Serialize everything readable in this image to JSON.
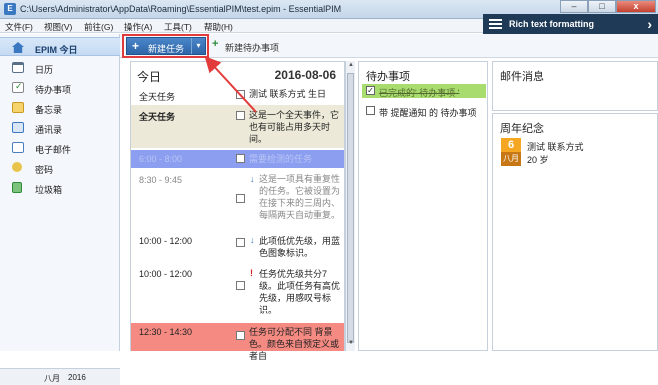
{
  "window": {
    "title": "C:\\Users\\Administrator\\AppData\\Roaming\\EssentialPIM\\test.epim - EssentialPIM"
  },
  "menu": [
    "文件(F)",
    "视图(V)",
    "前往(G)",
    "操作(A)",
    "工具(T)",
    "帮助(H)"
  ],
  "rich_text": {
    "label": "Rich text formatting",
    "close": "›"
  },
  "window_buttons": {
    "minimize": "–",
    "maximize": "□",
    "close": "x"
  },
  "sidebar": {
    "items": [
      {
        "label": "EPIM 今日",
        "icon": "home-icon",
        "color": "#3a78c2"
      },
      {
        "label": "日历",
        "icon": "calendar-icon",
        "color": "#5a6f88"
      },
      {
        "label": "待办事项",
        "icon": "todo-icon",
        "color": "#2f8a3a"
      },
      {
        "label": "备忘录",
        "icon": "notes-icon",
        "color": "#e0a020"
      },
      {
        "label": "通讯录",
        "icon": "contacts-icon",
        "color": "#3a78c2"
      },
      {
        "label": "电子邮件",
        "icon": "email-icon",
        "color": "#4a7fc0"
      },
      {
        "label": "密码",
        "icon": "key-icon",
        "color": "#c9a020"
      },
      {
        "label": "垃圾箱",
        "icon": "trash-icon",
        "color": "#2f8a3a"
      }
    ],
    "footer": {
      "month": "八月",
      "year": "2016"
    }
  },
  "toolbar": {
    "new_task": "新建任务",
    "new_task_dropdown": "▾",
    "new_todo": "新建待办事项"
  },
  "day": {
    "header": "今日",
    "date": "2016-08-06",
    "allday_label": "全天任务",
    "allday_text": "测试 联系方式 生日",
    "rows": [
      {
        "time": "全天任务",
        "text": "这是一个全天事件，它也有可能占用多天时间。",
        "bg": "#ece9d8",
        "color": "#222",
        "prio": ""
      },
      {
        "time": "6:00 - 8:00",
        "text": "需要检测的任务",
        "bg": "#8c9ef0",
        "color": "#b9c5f5",
        "prio": ""
      },
      {
        "time": "8:30 - 9:45",
        "text": "这是一项具有重复性的任务。它被设置为在接下来的三周内、每隔两天自动重复。",
        "bg": "#ffffff",
        "color": "#888",
        "prio": "↓"
      },
      {
        "time": "10:00 - 12:00",
        "text": "此项低优先级，用蓝色图象标识。",
        "bg": "#ffffff",
        "color": "#222",
        "prio": "↓"
      },
      {
        "time": "10:00 - 12:00",
        "text": "任务优先级共分7级。此项任务有高优先级，用感叹号标识。",
        "bg": "#ffffff",
        "color": "#222",
        "prio": "!"
      },
      {
        "time": "12:30 - 14:30",
        "text": "任务可分配不同 背景色。颜色来自预定义或者自",
        "bg": "#f48a82",
        "color": "#222",
        "prio": ""
      }
    ]
  },
  "todo": {
    "title": "待办事项",
    "items": [
      {
        "text": "已完成的'  待办事项 '",
        "checked": "✓",
        "bg": "#a8dc6e",
        "done": true
      },
      {
        "text": "带 提醒通知 的 待办事项",
        "checked": "",
        "bg": "#ffffff",
        "done": false
      }
    ]
  },
  "mail": {
    "title": "邮件消息"
  },
  "anniversary": {
    "title": "周年纪念",
    "day": "6",
    "month": "八月",
    "name": "测试 联系方式",
    "age": "20 岁"
  }
}
